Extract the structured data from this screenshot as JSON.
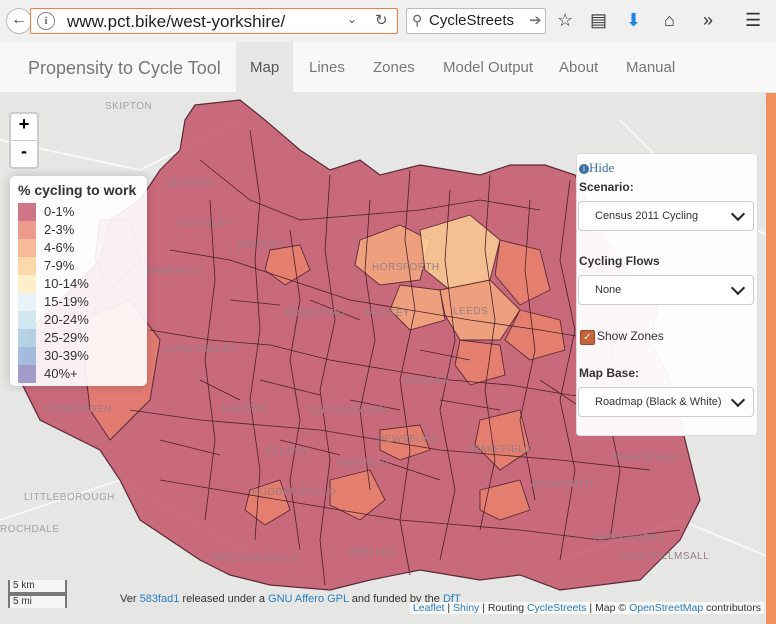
{
  "browser": {
    "url": "www.pct.bike/west-yorkshire/",
    "search_text": "CycleStreets"
  },
  "navbar": {
    "brand": "Propensity to Cycle Tool",
    "items": [
      "Map",
      "Lines",
      "Zones",
      "Model Output",
      "About",
      "Manual"
    ],
    "active": "Map"
  },
  "map": {
    "zoom_in": "+",
    "zoom_out": "-",
    "places": {
      "skipton": "SKIPTON",
      "silsden": "SILSDEN",
      "keighley": "KEIGHLEY",
      "bingley": "BINGLEY",
      "haworth": "HAWORTH",
      "horsforth": "HORSFORTH",
      "bradford": "BRADFORD",
      "pudsey": "PUDSEY",
      "leeds": "LEEDS",
      "queensbury": "QUEENSBURY",
      "morley": "MORLEY",
      "halifax": "HALIFAX",
      "cleckheaton": "CLECKHEATON",
      "todmorden": "TODMORDEN",
      "dewsbury": "DEWSBURY",
      "wakefield": "WAKEFIELD",
      "elland": "ELLAND",
      "mirfield": "MIRFIELD",
      "pontefract": "PONTEFRACT",
      "littleborough": "LITTLEBOROUGH",
      "huddersfield": "HUDDERSFIELD",
      "rochdale": "ROCHDALE",
      "holmfirth": "MELTHAM MILLS",
      "shelley": "SHELLEY",
      "hemsworth": "HEMSWORTH",
      "south_elmsall": "SOUTH ELMSALL",
      "ackworth": "ACKWORTH"
    },
    "scale": {
      "km": "5 km",
      "mi": "5 mi"
    }
  },
  "legend": {
    "title": "% cycling to work",
    "items": [
      {
        "label": "0-1%",
        "color": "#c3536a"
      },
      {
        "label": "2-3%",
        "color": "#e9826f"
      },
      {
        "label": "4-6%",
        "color": "#f5a97f"
      },
      {
        "label": "7-9%",
        "color": "#fbcf96"
      },
      {
        "label": "10-14%",
        "color": "#fdebb9"
      },
      {
        "label": "15-19%",
        "color": "#e2eff7"
      },
      {
        "label": "20-24%",
        "color": "#c6e1ef"
      },
      {
        "label": "25-29%",
        "color": "#a4c8e0"
      },
      {
        "label": "30-39%",
        "color": "#8eaed4"
      },
      {
        "label": "40%+",
        "color": "#8a86bc"
      }
    ]
  },
  "controls": {
    "hide": "Hide",
    "scenario_label": "Scenario:",
    "scenario_value": "Census 2011 Cycling",
    "flows_label": "Cycling Flows",
    "flows_value": "None",
    "show_zones_label": "Show Zones",
    "show_zones_checked": true,
    "mapbase_label": "Map Base:",
    "mapbase_value": "Roadmap (Black & White)"
  },
  "footer": {
    "ver_prefix": "Ver",
    "ver_hash": "583fad1",
    "released": "released under a",
    "license": "GNU Affero GPL",
    "funded": "and funded by the",
    "funder": "DfT",
    "leaflet": "Leaflet",
    "shiny": "Shiny",
    "routing": "Routing",
    "cyclestreets": "CycleStreets",
    "map_copy": "Map ©",
    "osm": "OpenStreetMap",
    "contributors": "contributors"
  }
}
